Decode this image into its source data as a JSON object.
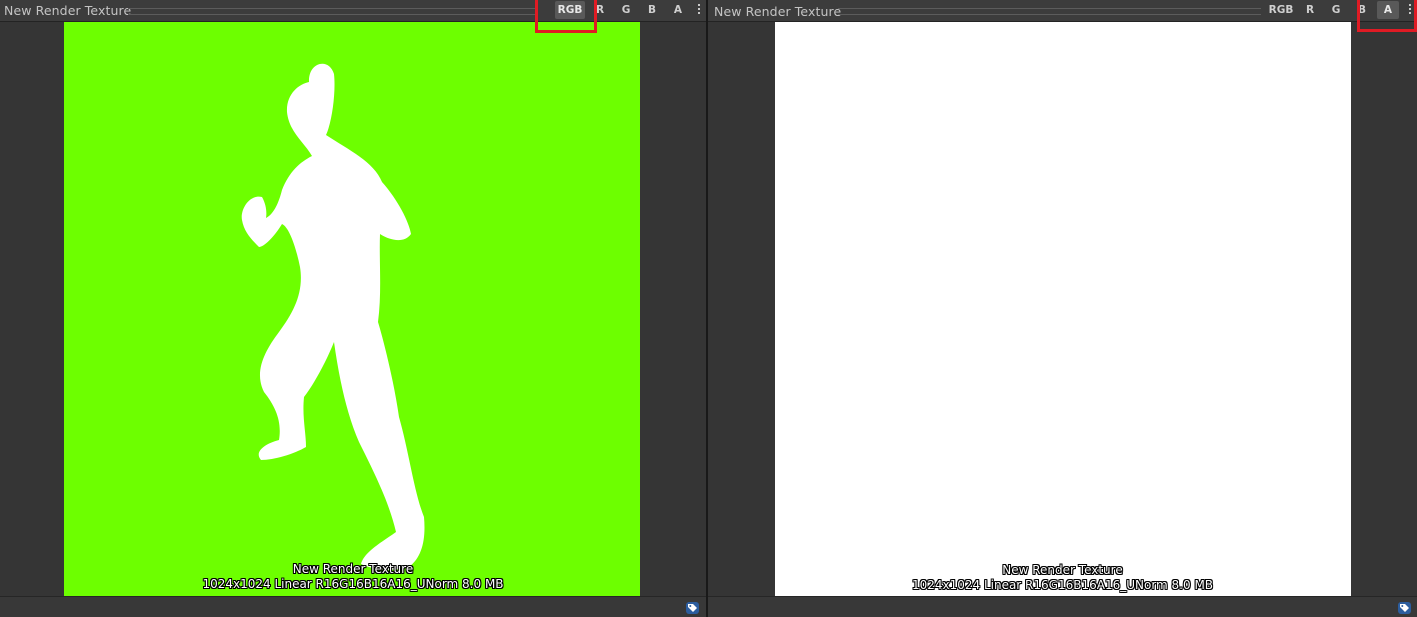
{
  "panels": [
    {
      "title": "New Render Texture",
      "channels": [
        "RGB",
        "R",
        "G",
        "B",
        "A"
      ],
      "active_channel": "RGB",
      "texture_name": "New Render Texture",
      "texture_info": "1024x1024 Linear  R16G16B16A16_UNorm  8.0 MB",
      "preview_color": "#6dff00"
    },
    {
      "title": "New Render Texture",
      "channels": [
        "RGB",
        "R",
        "G",
        "B",
        "A"
      ],
      "active_channel": "A",
      "texture_name": "New Render Texture",
      "texture_info": "1024x1024 Linear  R16G16B16A16_UNorm  8.0 MB",
      "preview_color": "#ffffff"
    }
  ],
  "icons": {
    "menu": "kebab-menu-icon",
    "asset_label": "tag-icon"
  },
  "colors": {
    "highlight": "#e01b24",
    "active_button": "#595959"
  }
}
